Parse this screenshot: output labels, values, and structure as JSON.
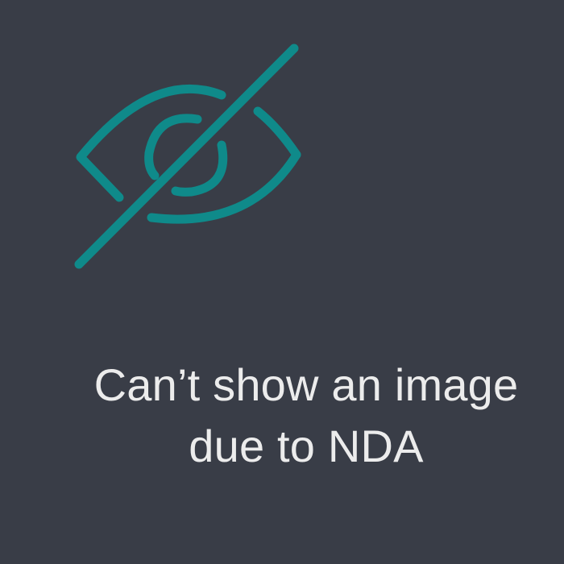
{
  "background_color": "#393d47",
  "icon": {
    "name": "eye-slash-icon",
    "color": "#0f8a8a"
  },
  "message": {
    "line1": "Can’t show an image",
    "line2": "due to NDA",
    "color": "#ececec"
  }
}
